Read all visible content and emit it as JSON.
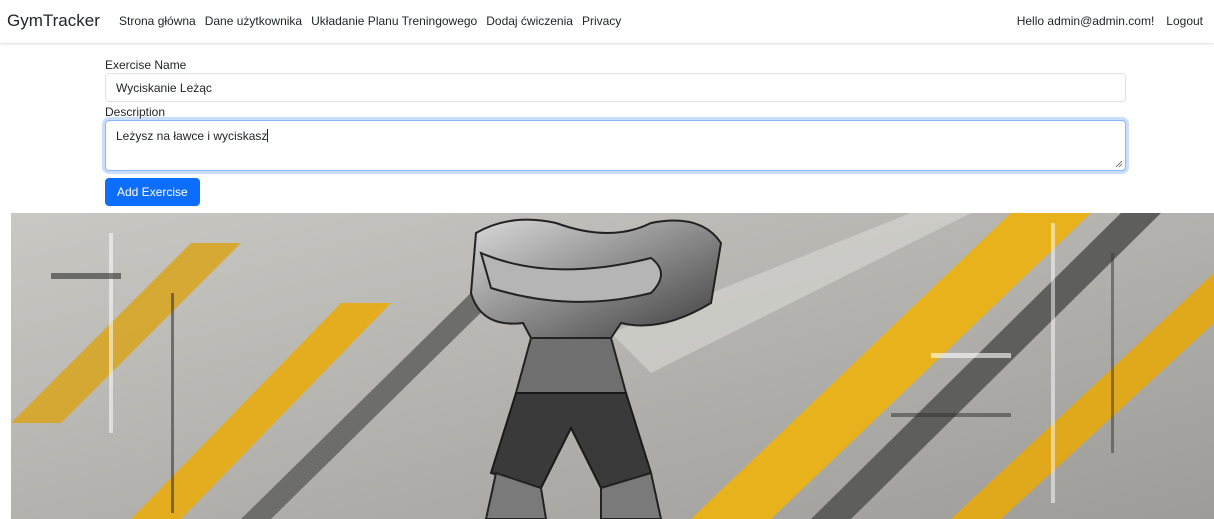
{
  "navbar": {
    "brand": "GymTracker",
    "links": [
      {
        "label": "Strona główna"
      },
      {
        "label": "Dane użytkownika"
      },
      {
        "label": "Układanie Planu Treningowego"
      },
      {
        "label": "Dodaj ćwiczenia"
      },
      {
        "label": "Privacy"
      }
    ],
    "greeting": "Hello admin@admin.com!",
    "logout": "Logout"
  },
  "form": {
    "name_label": "Exercise Name",
    "name_value": "Wyciskanie Leżąc",
    "description_label": "Description",
    "description_value": "Leżysz na ławce i wyciskasz",
    "submit_label": "Add Exercise"
  },
  "colors": {
    "primary": "#0d6efd",
    "hero_yellow": "#e8b21c",
    "hero_gray": "#8a8a86"
  }
}
